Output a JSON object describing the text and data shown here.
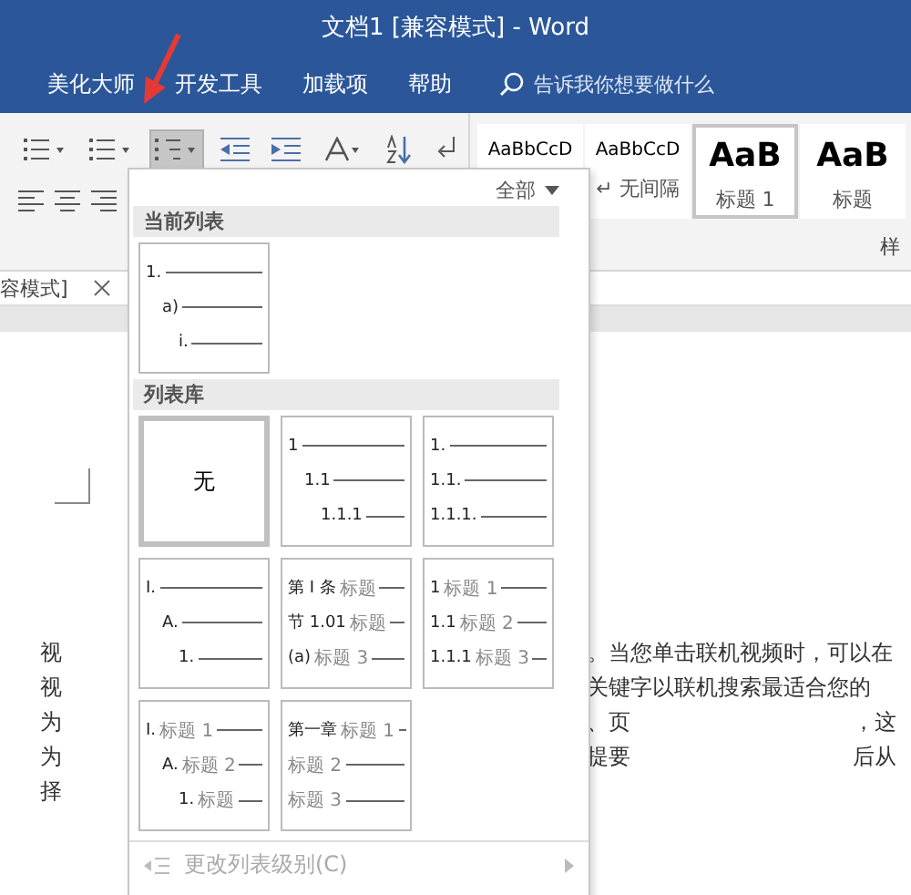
{
  "window": {
    "title": "文档1 [兼容模式] - Word"
  },
  "ribbon_tabs": [
    {
      "label": "美化大师"
    },
    {
      "label": "开发工具"
    },
    {
      "label": "加载项"
    },
    {
      "label": "帮助"
    }
  ],
  "tell_me": {
    "placeholder": "告诉我你想要做什么"
  },
  "tools": [
    {
      "kind": "bullets",
      "selected": false
    },
    {
      "kind": "numbering",
      "selected": false
    },
    {
      "kind": "multilevel",
      "selected": true
    },
    {
      "kind": "decrease-indent",
      "selected": false
    },
    {
      "kind": "increase-indent",
      "selected": false
    },
    {
      "kind": "asian-layout",
      "selected": false
    },
    {
      "kind": "sort",
      "selected": false
    },
    {
      "kind": "paragraph-mark",
      "selected": false
    }
  ],
  "styles": [
    {
      "kind": "body",
      "preview": "AaBbCcD",
      "selected": false
    },
    {
      "kind": "body",
      "preview": "AaBbCcD",
      "name": "↵ 无间隔",
      "selected": false
    },
    {
      "kind": "heading",
      "preview": "AaB",
      "name": "标题 1",
      "selected": true
    },
    {
      "kind": "heading",
      "preview": "AaB",
      "name": "标题",
      "selected": false
    }
  ],
  "group_label": "样",
  "doc_tab": {
    "title": "容模式]"
  },
  "dropdown": {
    "filter": "全部",
    "sections": [
      {
        "title": "当前列表",
        "items": [
          {
            "kind": "indented",
            "selected": false,
            "lines": [
              {
                "number": "1."
              },
              {
                "number": "a)"
              },
              {
                "number": "i."
              }
            ]
          }
        ]
      },
      {
        "title": "列表库",
        "items": [
          {
            "kind": "none",
            "label": "无",
            "selected": true
          },
          {
            "kind": "indented",
            "selected": false,
            "lines": [
              {
                "number": "1"
              },
              {
                "number": "1.1"
              },
              {
                "number": "1.1.1"
              }
            ]
          },
          {
            "kind": "flush",
            "selected": false,
            "lines": [
              {
                "number": "1."
              },
              {
                "number": "1.1."
              },
              {
                "number": "1.1.1."
              }
            ]
          },
          {
            "kind": "indented",
            "selected": false,
            "lines": [
              {
                "number": "I."
              },
              {
                "number": "A."
              },
              {
                "number": "1."
              }
            ]
          },
          {
            "kind": "flush",
            "selected": false,
            "lines": [
              {
                "number": "第 I 条",
                "heading": "标题"
              },
              {
                "number": "节 1.01",
                "heading": "标题"
              },
              {
                "number": "(a)",
                "heading": "标题 3"
              }
            ]
          },
          {
            "kind": "flush",
            "selected": false,
            "lines": [
              {
                "number": "1",
                "heading": "标题 1"
              },
              {
                "number": "1.1",
                "heading": "标题 2"
              },
              {
                "number": "1.1.1",
                "heading": "标题 3"
              }
            ]
          },
          {
            "kind": "indented",
            "selected": false,
            "lines": [
              {
                "number": "I.",
                "heading": "标题 1"
              },
              {
                "number": "A.",
                "heading": "标题 2"
              },
              {
                "number": "1.",
                "heading": "标题"
              }
            ]
          },
          {
            "kind": "flush",
            "selected": false,
            "lines": [
              {
                "number": "第一章",
                "heading": "标题 1"
              },
              {
                "heading": "标题 2"
              },
              {
                "heading": "标题 3"
              }
            ]
          }
        ]
      }
    ],
    "commands": [
      {
        "label": "更改列表级别(C)",
        "disabled": true,
        "submenu": true
      }
    ]
  },
  "document": {
    "lines": [
      {
        "left": "视",
        "right": [
          "。当您单击联机视频时，可以在"
        ]
      },
      {
        "left": "视",
        "right": [
          "关键字以联机搜索最适合您的"
        ]
      },
      {
        "left": "为",
        "right": [
          "、页",
          "，这"
        ]
      },
      {
        "left": "为",
        "right": [
          "提要",
          "后从"
        ]
      },
      {
        "left": "择"
      }
    ]
  }
}
